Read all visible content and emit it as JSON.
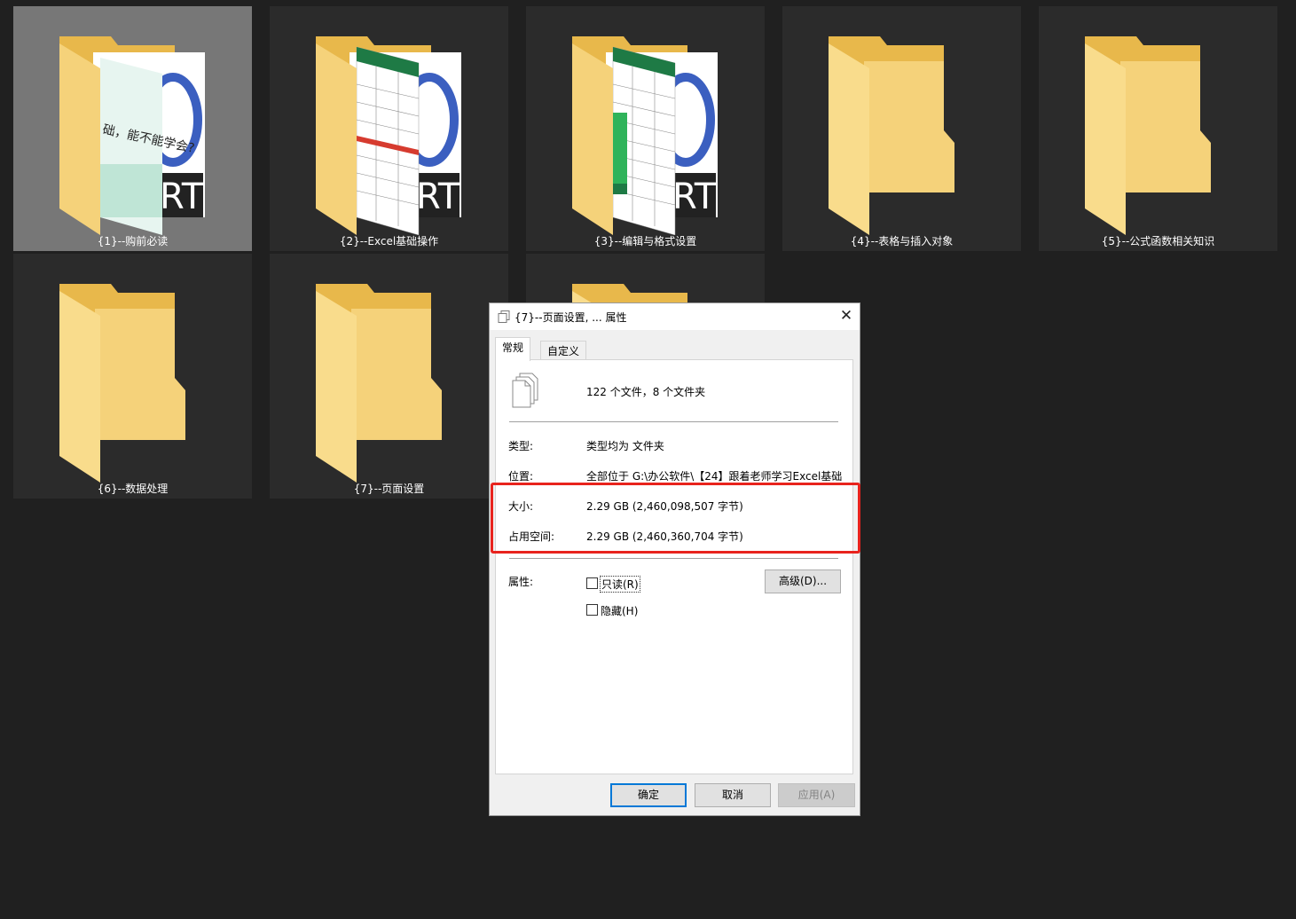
{
  "folders": [
    {
      "label": "{1}--购前必读",
      "thumb": "preview",
      "selected": true
    },
    {
      "label": "{2}--Excel基础操作",
      "thumb": "preview",
      "selected": false
    },
    {
      "label": "{3}--编辑与格式设置",
      "thumb": "preview",
      "selected": false
    },
    {
      "label": "{4}--表格与插入对象",
      "thumb": "plain",
      "selected": false
    },
    {
      "label": "{5}--公式函数相关知识",
      "thumb": "plain",
      "selected": false
    },
    {
      "label": "{6}--数据处理",
      "thumb": "plain",
      "selected": false
    },
    {
      "label": "{7}--页面设置",
      "thumb": "plain",
      "selected": false
    },
    {
      "label": "",
      "thumb": "plain",
      "selected": false
    }
  ],
  "preview_text": {
    "rt": "RT",
    "cover_text": "础，能不能学会?"
  },
  "dialog": {
    "title": "{7}--页面设置, ... 属性",
    "close_glyph": "✕",
    "tabs": [
      "常规",
      "自定义"
    ],
    "summary": "122 个文件，8 个文件夹",
    "type_label": "类型:",
    "type_value": "类型均为 文件夹",
    "location_label": "位置:",
    "location_value": "全部位于 G:\\办公软件\\【24】跟着老师学习Excel基础",
    "size_label": "大小:",
    "size_value": "2.29 GB (2,460,098,507 字节)",
    "disk_label": "占用空间:",
    "disk_value": "2.29 GB (2,460,360,704 字节)",
    "attr_label": "属性:",
    "readonly_label": "只读(R)",
    "hidden_label": "隐藏(H)",
    "advanced_label": "高级(D)...",
    "ok_label": "确定",
    "cancel_label": "取消",
    "apply_label": "应用(A)"
  },
  "colors": {
    "folder": "#f5d27a",
    "folder_dark": "#e8b84b",
    "highlight": "#e8231d",
    "accent": "#0078d7"
  }
}
